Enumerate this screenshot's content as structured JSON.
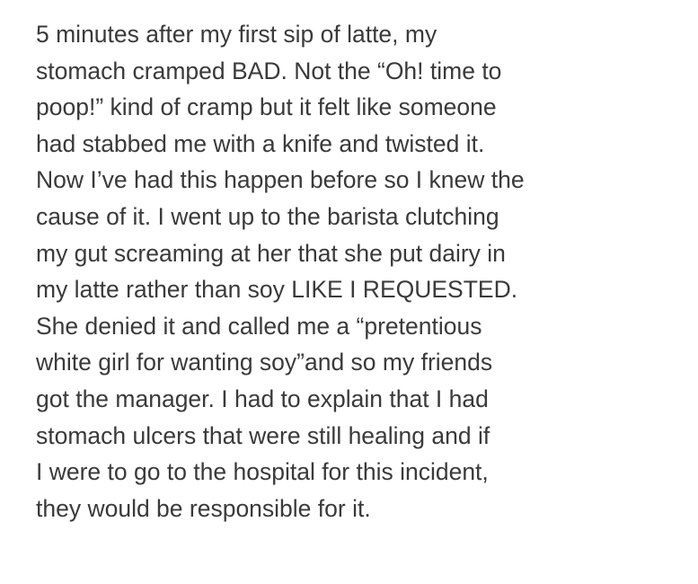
{
  "post": {
    "lines": [
      "5 minutes after my first sip of latte, my",
      "stomach cramped BAD. Not the “Oh! time to",
      "poop!” kind of cramp but it felt like someone",
      "had stabbed me with a knife and twisted it.",
      "Now I’ve had this happen before so I knew the",
      "cause of it. I went up to the barista clutching",
      "my gut screaming at her that she put dairy in",
      "my latte rather than soy LIKE I REQUESTED.",
      "She denied it and called me a “pretentious",
      "white girl for wanting soy”and so my friends",
      "got the manager. I had to explain that I had",
      "stomach ulcers that were still healing and if",
      "I were to go to the hospital for this incident,",
      "they would be responsible for it."
    ]
  }
}
